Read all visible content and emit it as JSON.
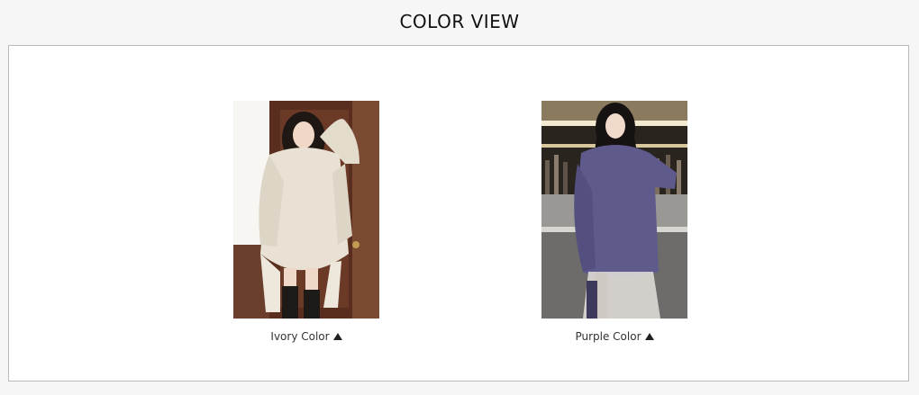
{
  "page": {
    "title": "COLOR VIEW"
  },
  "colors": [
    {
      "label": "Ivory Color",
      "swatch": "#e9e2d4",
      "icon": "triangle-up-icon"
    },
    {
      "label": "Purple Color",
      "swatch": "#5e5a8c",
      "icon": "triangle-up-icon"
    }
  ]
}
